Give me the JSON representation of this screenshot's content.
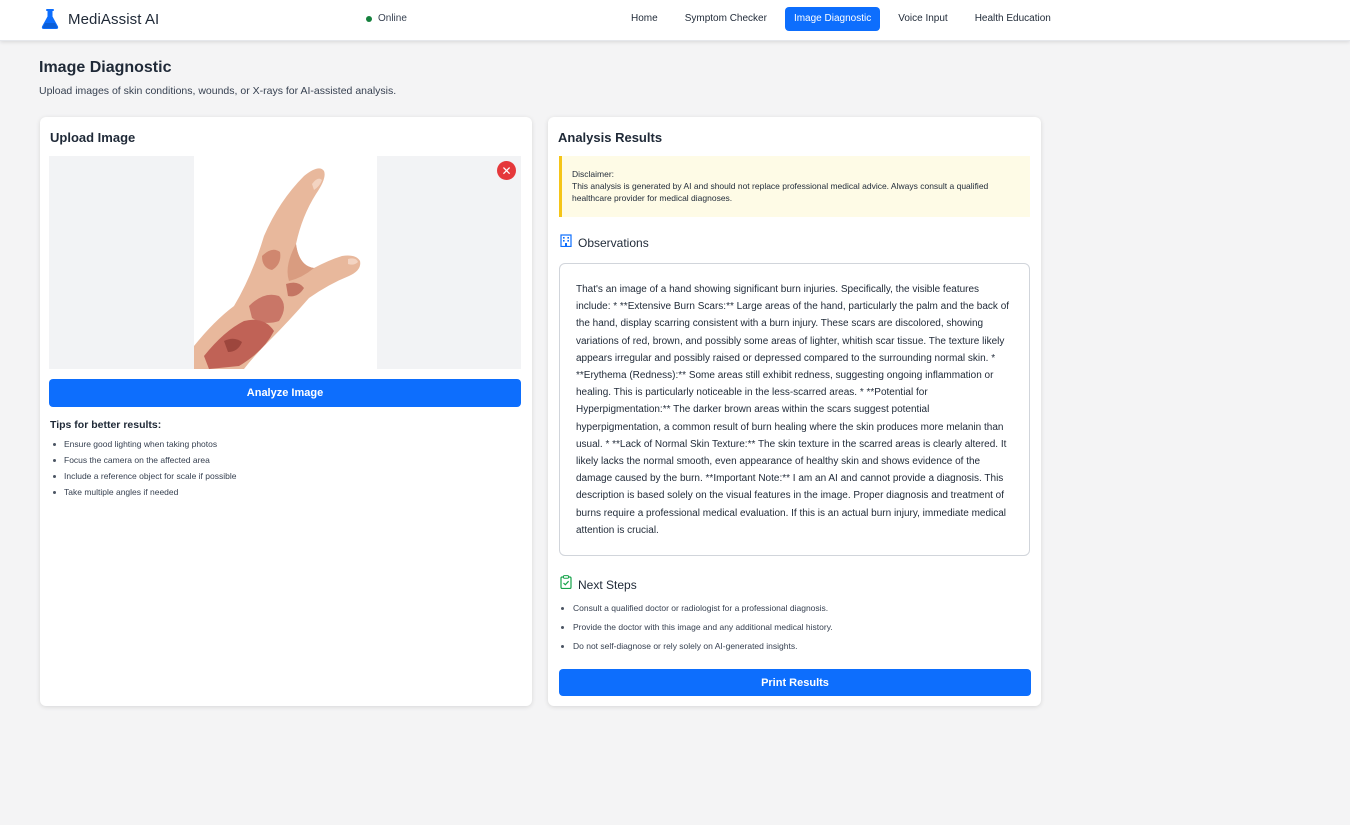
{
  "app": {
    "name": "MediAssist AI",
    "logo_icon": "flask-icon",
    "status": "Online",
    "status_color": "#15803d"
  },
  "nav": {
    "items": [
      {
        "label": "Home",
        "active": false
      },
      {
        "label": "Symptom Checker",
        "active": false
      },
      {
        "label": "Image Diagnostic",
        "active": true
      },
      {
        "label": "Voice Input",
        "active": false
      },
      {
        "label": "Health Education",
        "active": false
      }
    ]
  },
  "page": {
    "title": "Image Diagnostic",
    "subtitle": "Upload images of skin conditions, wounds, or X-rays for AI-assisted analysis."
  },
  "upload": {
    "title": "Upload Image",
    "remove_icon": "close-icon",
    "analyze_label": "Analyze Image",
    "tips_title": "Tips for better results:",
    "tips": [
      "Ensure good lighting when taking photos",
      "Focus the camera on the affected area",
      "Include a reference object for scale if possible",
      "Take multiple angles if needed"
    ]
  },
  "results": {
    "title": "Analysis Results",
    "disclaimer_title": "Disclaimer:",
    "disclaimer_text": "This analysis is generated by AI and should not replace professional medical advice. Always consult a qualified healthcare provider for medical diagnoses.",
    "observations_title": "Observations",
    "observations_icon": "hospital-icon",
    "observations_text": "That's an image of a hand showing significant burn injuries. Specifically, the visible features include: * **Extensive Burn Scars:** Large areas of the hand, particularly the palm and the back of the hand, display scarring consistent with a burn injury. These scars are discolored, showing variations of red, brown, and possibly some areas of lighter, whitish scar tissue. The texture likely appears irregular and possibly raised or depressed compared to the surrounding normal skin. * **Erythema (Redness):** Some areas still exhibit redness, suggesting ongoing inflammation or healing. This is particularly noticeable in the less-scarred areas. * **Potential for Hyperpigmentation:** The darker brown areas within the scars suggest potential hyperpigmentation, a common result of burn healing where the skin produces more melanin than usual. * **Lack of Normal Skin Texture:** The skin texture in the scarred areas is clearly altered. It likely lacks the normal smooth, even appearance of healthy skin and shows evidence of the damage caused by the burn. **Important Note:** I am an AI and cannot provide a diagnosis. This description is based solely on the visual features in the image. Proper diagnosis and treatment of burns require a professional medical evaluation. If this is an actual burn injury, immediate medical attention is crucial.",
    "next_steps_title": "Next Steps",
    "next_steps_icon": "clipboard-check-icon",
    "next_steps": [
      "Consult a qualified doctor or radiologist for a professional diagnosis.",
      "Provide the doctor with this image and any additional medical history.",
      "Do not self-diagnose or rely solely on AI-generated insights."
    ],
    "print_label": "Print Results"
  },
  "colors": {
    "primary": "#0d6efd",
    "danger": "#e5383b",
    "warning_border": "#f5c518",
    "warning_bg": "#fefbe6"
  }
}
